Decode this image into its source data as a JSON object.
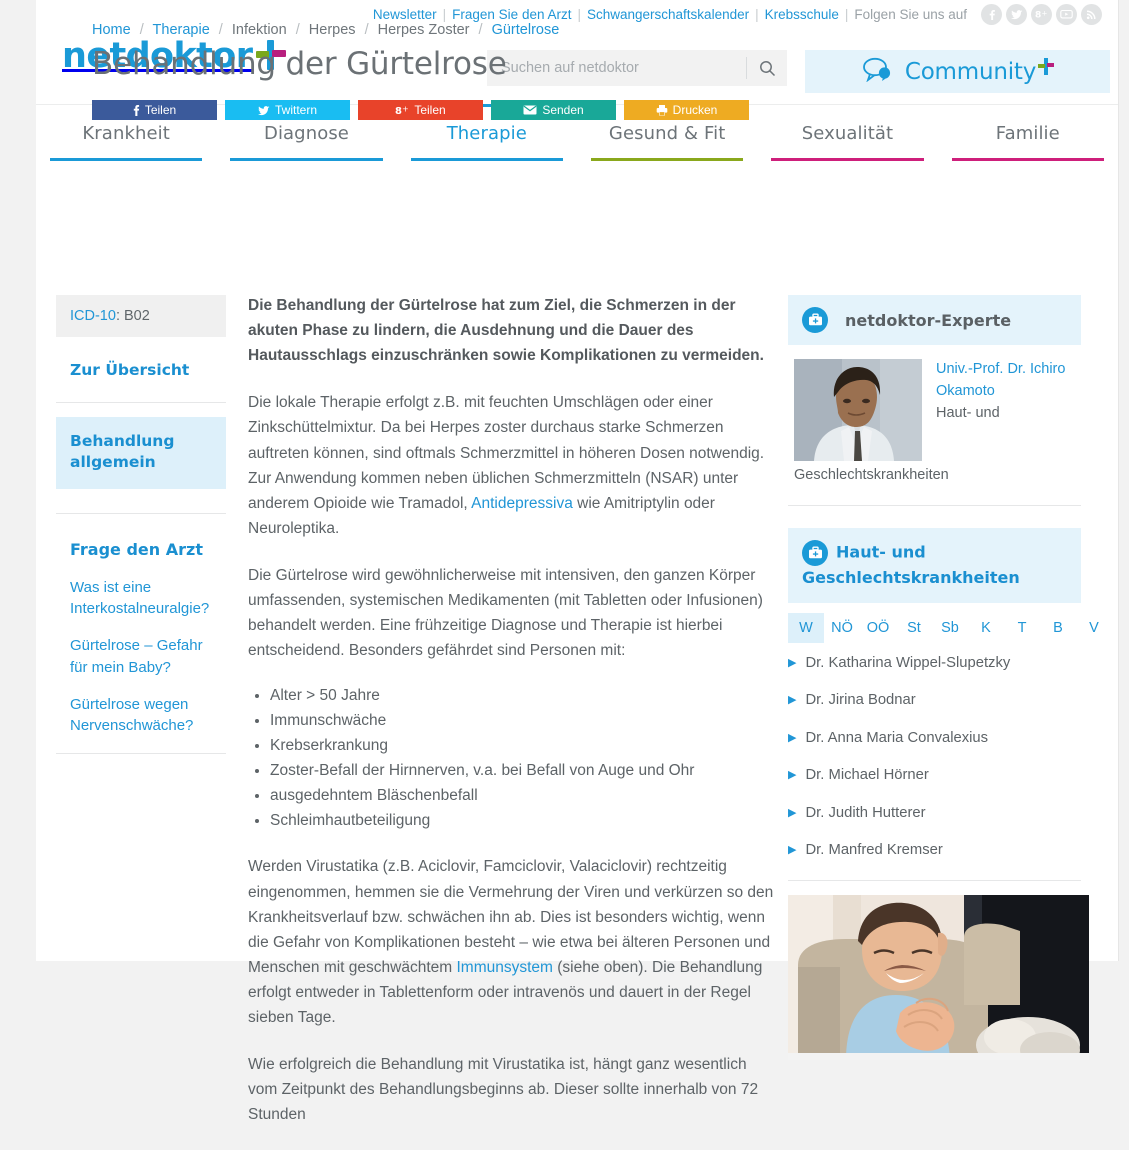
{
  "topbar": {
    "links": [
      {
        "label": "Newsletter"
      },
      {
        "label": "Fragen Sie den Arzt"
      },
      {
        "label": "Schwangerschaftskalender"
      },
      {
        "label": "Krebsschule"
      }
    ],
    "follow_label": "Folgen Sie uns auf",
    "social": [
      {
        "name": "facebook-icon"
      },
      {
        "name": "twitter-icon"
      },
      {
        "name": "googleplus-icon"
      },
      {
        "name": "youtube-icon"
      },
      {
        "name": "rss-icon"
      }
    ]
  },
  "header": {
    "logo_text": "netdoktor",
    "search": {
      "placeholder": "Suchen auf netdoktor",
      "value": "",
      "icon": "search-icon"
    },
    "community": {
      "label": "Community",
      "icon": "speech-bubble-icon",
      "bg": "#e4f3fb"
    }
  },
  "nav": {
    "items": [
      {
        "label": "Krankheit",
        "underline": "#1a9ad7",
        "active": false
      },
      {
        "label": "Diagnose",
        "underline": "#1a9ad7",
        "active": false
      },
      {
        "label": "Therapie",
        "underline": "#1a9ad7",
        "active": true
      },
      {
        "label": "Gesund & Fit",
        "underline": "#8aa81c",
        "active": false
      },
      {
        "label": "Sexualität",
        "underline": "#ce1f7b",
        "active": false
      },
      {
        "label": "Familie",
        "underline": "#ce1f7b",
        "active": false
      }
    ]
  },
  "breadcrumb": [
    {
      "label": "Home",
      "link": true
    },
    {
      "label": "Therapie",
      "link": true
    },
    {
      "label": "Infektion",
      "link": false
    },
    {
      "label": "Herpes",
      "link": false
    },
    {
      "label": "Herpes Zoster",
      "link": false
    },
    {
      "label": "Gürtelrose",
      "link": true
    }
  ],
  "page_title": "Behandlung der Gürtelrose",
  "share_buttons": [
    {
      "label": "Teilen",
      "icon": "facebook-icon",
      "color": "#3b5a9b"
    },
    {
      "label": "Twittern",
      "icon": "twitter-icon",
      "color": "#19bdf2"
    },
    {
      "label": "Teilen",
      "icon": "googleplus-icon",
      "color": "#e8432a"
    },
    {
      "label": "Senden",
      "icon": "mail-icon",
      "color": "#19a898"
    },
    {
      "label": "Drucken",
      "icon": "printer-icon",
      "color": "#eeab22"
    }
  ],
  "left_sidebar": {
    "icd_label": "ICD-10",
    "icd_value": ": B02",
    "overview_link": "Zur Übersicht",
    "active_section": "Behandlung allgemein",
    "ask_doctor": {
      "heading": "Frage den Arzt",
      "questions": [
        "Was ist eine Interkostalneuralgie?",
        "Gürtelrose – Gefahr für mein Baby?",
        "Gürtelrose wegen Nervenschwäche?"
      ]
    }
  },
  "article": {
    "lead": "Die Behandlung der Gürtelrose hat zum Ziel, die Schmerzen in der akuten Phase zu lindern, die Ausdehnung und die Dauer des Hautausschlags einzuschränken sowie Komplikationen zu vermeiden.",
    "p2_a": "Die lokale Therapie erfolgt z.B. mit feuchten Umschlägen oder einer Zinkschüttelmixtur. Da bei Herpes zoster durchaus starke Schmerzen auftreten können, sind oftmals Schmerzmittel in höheren Dosen notwendig. Zur Anwendung kommen neben üblichen Schmerzmitteln (NSAR) unter anderem Opioide wie Tramadol, ",
    "p2_link": "Antidepressiva",
    "p2_b": " wie Amitriptylin oder Neuroleptika.",
    "p3": "Die Gürtelrose wird gewöhnlicherweise mit intensiven, den ganzen Körper umfassenden, systemischen Medikamenten (mit Tabletten oder Infusionen) behandelt werden. Eine frühzeitige Diagnose und Therapie ist hierbei entscheidend. Besonders gefährdet sind Personen mit:",
    "risk_list": [
      "Alter > 50 Jahre",
      "Immunschwäche",
      "Krebserkrankung",
      "Zoster-Befall der Hirnnerven, v.a. bei Befall von Auge und Ohr",
      "ausgedehntem Bläschenbefall",
      "Schleimhautbeteiligung"
    ],
    "p4_a": "Werden Virustatika (z.B. Aciclovir, Famciclovir, Valaciclovir) rechtzeitig eingenommen, hemmen sie die Vermehrung der Viren und verkürzen so den Krankheitsverlauf bzw. schwächen ihn ab. Dies ist besonders wichtig, wenn die Gefahr von Komplikationen besteht – wie etwa bei älteren Personen und Menschen mit geschwächtem ",
    "p4_link": "Immunsystem",
    "p4_b": " (siehe oben). Die Behandlung erfolgt entweder in Tablettenform oder intravenös und dauert in der Regel sieben Tage.",
    "p5": "Wie erfolgreich die Behandlung mit Virustatika ist, hängt ganz wesentlich vom Zeitpunkt des Behandlungsbeginns ab. Dieser sollte innerhalb von 72 Stunden"
  },
  "right_sidebar": {
    "expert_card": {
      "title": "netdoktor-Experte",
      "icon": "medical-bag-icon",
      "name": "Univ.-Prof. Dr. Ichiro Okamoto",
      "specialty_line1": "Haut- und",
      "specialty_line2": "Geschlechtskrankheiten"
    },
    "doctors_card": {
      "title_line1": "Haut- und",
      "title_line2": "Geschlechtskrankheiten",
      "icon": "medical-bag-icon",
      "regions": [
        {
          "label": "W",
          "active": true
        },
        {
          "label": "NÖ",
          "active": false
        },
        {
          "label": "OÖ",
          "active": false
        },
        {
          "label": "St",
          "active": false
        },
        {
          "label": "Sb",
          "active": false
        },
        {
          "label": "K",
          "active": false
        },
        {
          "label": "T",
          "active": false
        },
        {
          "label": "B",
          "active": false
        },
        {
          "label": "V",
          "active": false
        }
      ],
      "doctors": [
        "Dr. Katharina Wippel-Slupetzky",
        "Dr. Jirina Bodnar",
        "Dr. Anna Maria Convalexius",
        "Dr. Michael Hörner",
        "Dr. Judith Hutterer",
        "Dr. Manfred Kremser"
      ]
    },
    "promo_image_alt": "Lachender Junge im hellblauen Hemd"
  }
}
